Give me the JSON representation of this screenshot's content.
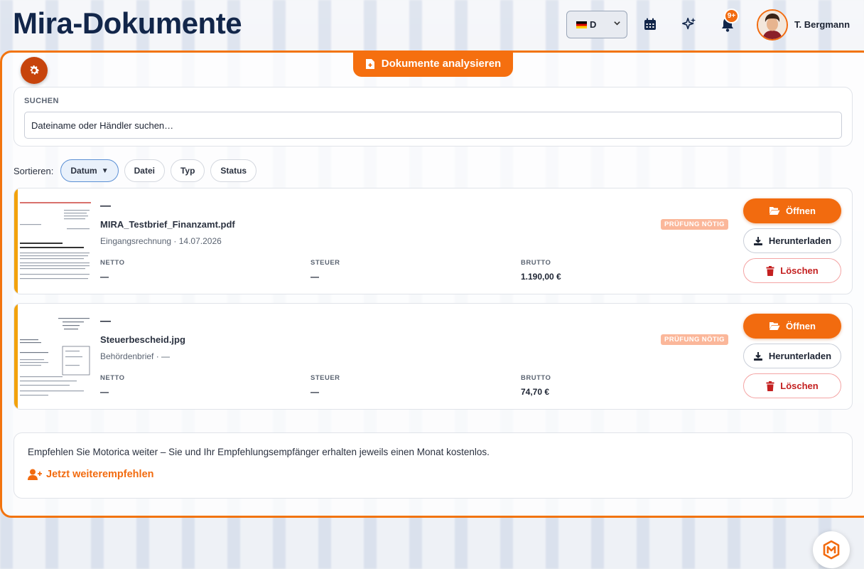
{
  "app": {
    "title": "Mira-Dokumente"
  },
  "header": {
    "language": "D",
    "notification_badge": "9+",
    "user_name": "T. Bergmann"
  },
  "toolbar": {
    "analyze_label": "Dokumente analysieren"
  },
  "search": {
    "label": "SUCHEN",
    "placeholder": "Dateiname oder Händler suchen…"
  },
  "sort": {
    "label": "Sortieren:",
    "options": [
      {
        "label": "Datum",
        "active": true,
        "indicator": "▼"
      },
      {
        "label": "Datei"
      },
      {
        "label": "Typ"
      },
      {
        "label": "Status"
      }
    ]
  },
  "amount_labels": {
    "net": "NETTO",
    "tax": "STEUER",
    "gross": "BRUTTO"
  },
  "actions": {
    "open": "Öffnen",
    "download": "Herunterladen",
    "delete": "Löschen"
  },
  "documents": [
    {
      "title": "—",
      "filename": "MIRA_Testbrief_Finanzamt.pdf",
      "meta": "Eingangsrechnung · 14.07.2026",
      "status": "PRÜFUNG NÖTIG",
      "net": "—",
      "tax": "—",
      "gross": "1.190,00 €"
    },
    {
      "title": "—",
      "filename": "Steuerbescheid.jpg",
      "meta": "Behördenbrief · —",
      "status": "PRÜFUNG NÖTIG",
      "net": "—",
      "tax": "—",
      "gross": "74,70 €"
    }
  ],
  "referral": {
    "text": "Empfehlen Sie Motorica weiter – Sie und Ihr Empfehlungsempfänger erhalten jeweils einen Monat kostenlos.",
    "link": "Jetzt weiterempfehlen"
  },
  "colors": {
    "accent": "#f26b0f",
    "navy": "#12264a",
    "danger": "#c42020",
    "status_bar": "#f2a20c"
  }
}
